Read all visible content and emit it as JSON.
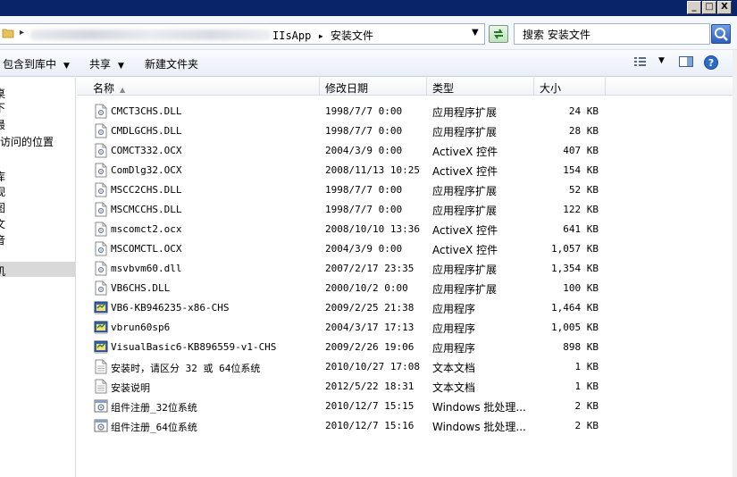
{
  "window": {
    "minimize_label": "_",
    "maximize_label": "□",
    "close_label": "X"
  },
  "address": {
    "path_visible": "IIsApp ▸ 安装文件",
    "search_placeholder": "搜索 安装文件"
  },
  "toolbar": {
    "include_in_library": "包含到库中",
    "share": "共享",
    "new_folder": "新建文件夹"
  },
  "nav": {
    "items": [
      {
        "label": "桌"
      },
      {
        "label": "下"
      },
      {
        "label": "最"
      },
      {
        "label": "访问的位置"
      },
      {
        "label": "库"
      },
      {
        "label": "视"
      },
      {
        "label": "图"
      },
      {
        "label": "文"
      },
      {
        "label": "音"
      },
      {
        "label": "机"
      }
    ]
  },
  "columns": {
    "name": "名称",
    "date": "修改日期",
    "type": "类型",
    "size": "大小"
  },
  "files": [
    {
      "name": "CMCT3CHS.DLL",
      "date": "1998/7/7 0:00",
      "type": "应用程序扩展",
      "size": "24 KB",
      "icon": "dll-icon"
    },
    {
      "name": "CMDLGCHS.DLL",
      "date": "1998/7/7 0:00",
      "type": "应用程序扩展",
      "size": "28 KB",
      "icon": "dll-icon"
    },
    {
      "name": "COMCT332.OCX",
      "date": "2004/3/9 0:00",
      "type": "ActiveX 控件",
      "size": "407 KB",
      "icon": "ocx-icon"
    },
    {
      "name": "ComDlg32.OCX",
      "date": "2008/11/13 10:25",
      "type": "ActiveX 控件",
      "size": "154 KB",
      "icon": "ocx-icon"
    },
    {
      "name": "MSCC2CHS.DLL",
      "date": "1998/7/7 0:00",
      "type": "应用程序扩展",
      "size": "52 KB",
      "icon": "dll-icon"
    },
    {
      "name": "MSCMCCHS.DLL",
      "date": "1998/7/7 0:00",
      "type": "应用程序扩展",
      "size": "122 KB",
      "icon": "dll-icon"
    },
    {
      "name": "mscomct2.ocx",
      "date": "2008/10/10 13:36",
      "type": "ActiveX 控件",
      "size": "641 KB",
      "icon": "ocx-icon"
    },
    {
      "name": "MSCOMCTL.OCX",
      "date": "2004/3/9 0:00",
      "type": "ActiveX 控件",
      "size": "1,057 KB",
      "icon": "ocx-icon"
    },
    {
      "name": "msvbvm60.dll",
      "date": "2007/2/17 23:35",
      "type": "应用程序扩展",
      "size": "1,354 KB",
      "icon": "dll-icon"
    },
    {
      "name": "VB6CHS.DLL",
      "date": "2000/10/2 0:00",
      "type": "应用程序扩展",
      "size": "100 KB",
      "icon": "dll-icon"
    },
    {
      "name": "VB6-KB946235-x86-CHS",
      "date": "2009/2/25 21:38",
      "type": "应用程序",
      "size": "1,464 KB",
      "icon": "exe-icon"
    },
    {
      "name": "vbrun60sp6",
      "date": "2004/3/17 17:13",
      "type": "应用程序",
      "size": "1,005 KB",
      "icon": "exe-icon"
    },
    {
      "name": "VisualBasic6-KB896559-v1-CHS",
      "date": "2009/2/26 19:06",
      "type": "应用程序",
      "size": "898 KB",
      "icon": "exe-icon"
    },
    {
      "name": "安装时，请区分 32 或 64位系统",
      "date": "2010/10/27 17:08",
      "type": "文本文档",
      "size": "1 KB",
      "icon": "txt-icon"
    },
    {
      "name": "安装说明",
      "date": "2012/5/22 18:31",
      "type": "文本文档",
      "size": "1 KB",
      "icon": "txt-icon"
    },
    {
      "name": "组件注册_32位系统",
      "date": "2010/12/7 15:15",
      "type": "Windows 批处理...",
      "size": "2 KB",
      "icon": "bat-icon"
    },
    {
      "name": "组件注册_64位系统",
      "date": "2010/12/7 15:16",
      "type": "Windows 批处理...",
      "size": "2 KB",
      "icon": "bat-icon"
    }
  ]
}
